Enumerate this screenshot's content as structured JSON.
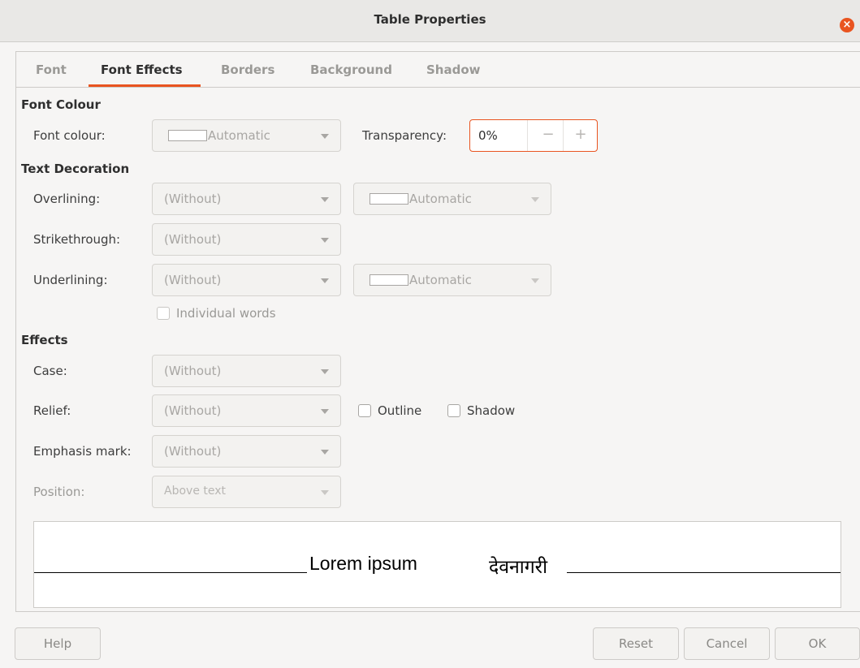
{
  "window": {
    "title": "Table Properties"
  },
  "tabs": [
    {
      "label": "Font"
    },
    {
      "label": "Font Effects"
    },
    {
      "label": "Borders"
    },
    {
      "label": "Background"
    },
    {
      "label": "Shadow"
    }
  ],
  "font_colour": {
    "heading": "Font Colour",
    "label": "Font colour:",
    "value": "Automatic",
    "transparency_label": "Transparency:",
    "transparency_value": "0%",
    "minus": "−",
    "plus": "+"
  },
  "text_decoration": {
    "heading": "Text Decoration",
    "overlining_label": "Overlining:",
    "overlining_value": "(Without)",
    "overlining_color": "Automatic",
    "strikethrough_label": "Strikethrough:",
    "strikethrough_value": "(Without)",
    "underlining_label": "Underlining:",
    "underlining_value": "(Without)",
    "underlining_color": "Automatic",
    "individual_words": "Individual words"
  },
  "effects": {
    "heading": "Effects",
    "case_label": "Case:",
    "case_value": "(Without)",
    "relief_label": "Relief:",
    "relief_value": "(Without)",
    "outline_label": "Outline",
    "shadow_label": "Shadow",
    "emphasis_label": "Emphasis mark:",
    "emphasis_value": "(Without)",
    "position_label": "Position:",
    "position_value": "Above text"
  },
  "preview": {
    "latin": "Lorem ipsum",
    "devanagari": "देवनागरी"
  },
  "buttons": {
    "help": "Help",
    "reset": "Reset",
    "cancel": "Cancel",
    "ok": "OK"
  },
  "colors": {
    "accent": "#e95420"
  }
}
